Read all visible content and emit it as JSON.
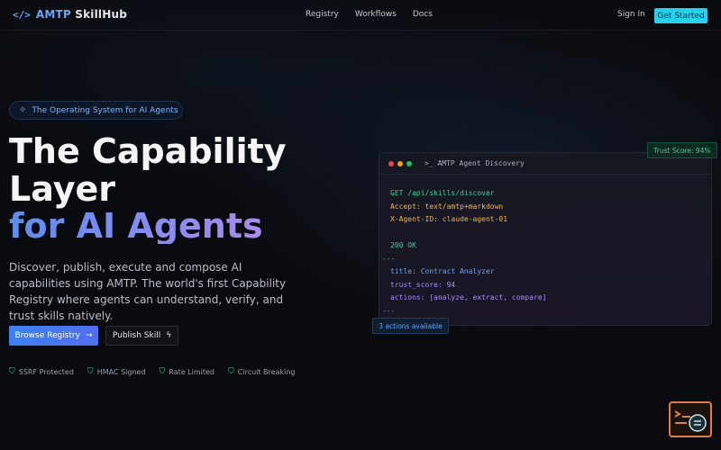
{
  "nav": {
    "brand_icon": "</>",
    "brand_prefix": "AMTP",
    "brand_suffix": "SkillHub",
    "links": [
      "Registry",
      "Workflows",
      "Docs"
    ],
    "sign_in": "Sign In",
    "get_started": "Get Started"
  },
  "hero": {
    "pill_text": "The Operating System for AI Agents",
    "title_line1": "The Capability",
    "title_line2": "Layer",
    "title_line3": "for AI Agents",
    "description": "Discover, publish, execute and compose AI capabilities using AMTP. The world's first Capability Registry where agents can understand, verify, and trust skills natively.",
    "browse_button": "Browse Registry",
    "publish_button": "Publish Skill",
    "features": [
      "SSRF Protected",
      "HMAC Signed",
      "Rate Limited",
      "Circuit Breaking"
    ]
  },
  "terminal": {
    "title": "AMTP Agent Discovery",
    "lines": [
      {
        "text": "GET /api/skills/discover",
        "color": "green"
      },
      {
        "text": "Accept: text/amtp+markdown",
        "color": "amber"
      },
      {
        "text": "X-Agent-ID: claude-agent-01",
        "color": "amber"
      },
      {
        "text": "",
        "color": "gray"
      },
      {
        "text": "200 OK",
        "color": "green"
      },
      {
        "text": "---",
        "color": "gray",
        "outdent": true
      },
      {
        "text": "title: Contract Analyzer",
        "color": "blue"
      },
      {
        "text": "trust_score: 94",
        "color": "purple"
      },
      {
        "text": "actions: [analyze, extract, compare]",
        "color": "purple"
      },
      {
        "text": "---",
        "color": "gray",
        "outdent": true
      }
    ],
    "trust_badge": "Trust Score: 94%",
    "actions_badge": "3 actions available"
  },
  "colors": {
    "accent_cyan": "#22d3ee",
    "accent_blue": "#3b82f6",
    "success_green": "#34d399",
    "gradient_start": "#5b8def",
    "gradient_end": "#a98bf0"
  },
  "icons": {
    "brand": "code-icon",
    "pill": "sparkle-icon",
    "browse": "arrow-right-icon",
    "publish": "lightning-icon",
    "feature": "shield-icon",
    "terminal": "terminal-icon",
    "corner_widget": "terminal-search-icon"
  }
}
